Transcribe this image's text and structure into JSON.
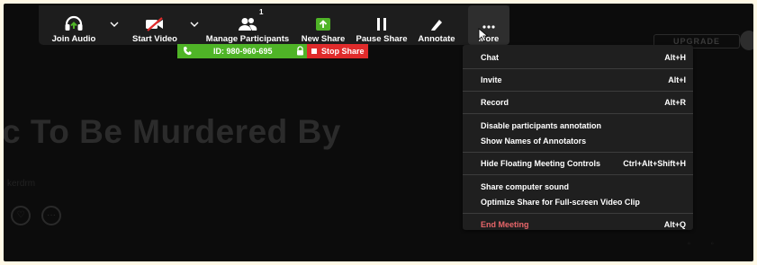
{
  "background": {
    "title": "c To Be Murdered By",
    "subtitle": "kerdrm",
    "upgrade_label": "UPGRADE"
  },
  "toolbar": {
    "join_audio": "Join Audio",
    "start_video": "Start Video",
    "manage_participants": "Manage Participants",
    "participant_count": "1",
    "new_share": "New Share",
    "pause_share": "Pause Share",
    "annotate": "Annotate",
    "more": "More"
  },
  "share_bar": {
    "meeting_id": "ID: 980-960-695",
    "stop_share": "Stop Share"
  },
  "more_menu": {
    "chat": {
      "label": "Chat",
      "shortcut": "Alt+H"
    },
    "invite": {
      "label": "Invite",
      "shortcut": "Alt+I"
    },
    "record": {
      "label": "Record",
      "shortcut": "Alt+R"
    },
    "disable_annotation": "Disable participants annotation",
    "show_annotators": "Show Names of Annotators",
    "hide_controls": {
      "label": "Hide Floating Meeting Controls",
      "shortcut": "Ctrl+Alt+Shift+H"
    },
    "share_sound": "Share computer sound",
    "optimize_share": "Optimize Share for Full-screen Video Clip",
    "end_meeting": {
      "label": "End Meeting",
      "shortcut": "Alt+Q"
    }
  },
  "colors": {
    "share_green": "#4fb427",
    "stop_red": "#e02b2b",
    "end_meeting_red": "#e8666a"
  }
}
